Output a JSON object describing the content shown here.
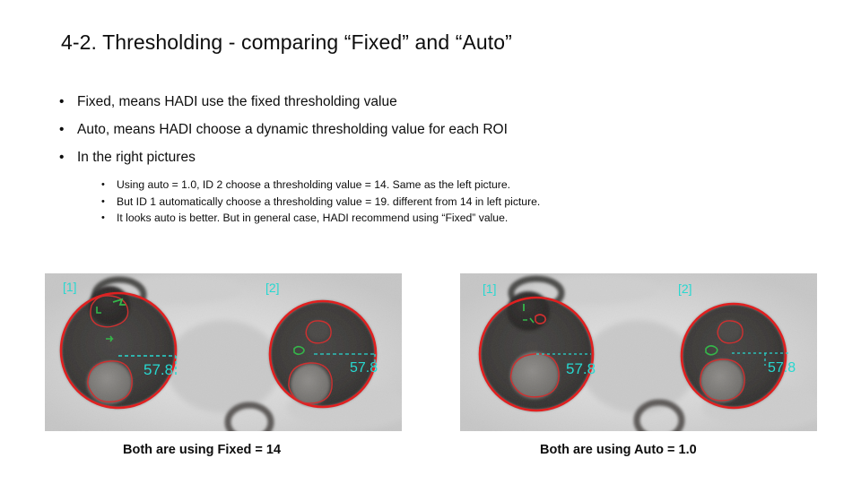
{
  "slide": {
    "title": "4-2. Thresholding  - comparing “Fixed” and “Auto”"
  },
  "bullets": [
    {
      "level": 1,
      "marker": "•",
      "text": "Fixed, means HADI use the fixed thresholding value"
    },
    {
      "level": 1,
      "marker": "•",
      "text": "Auto, means HADI choose a dynamic thresholding value for each ROI"
    },
    {
      "level": 1,
      "marker": "•",
      "text": "In the right pictures"
    }
  ],
  "subbullets": [
    {
      "marker": "•",
      "text": "Using auto = 1.0, ID 2 choose a thresholding value = 14. Same as the left picture."
    },
    {
      "marker": "•",
      "text": "But ID 1 automatically choose a thresholding value = 19. different from 14 in left picture."
    },
    {
      "marker": "•",
      "text": "It looks auto is better. But in general case, HADI recommend using “Fixed” value."
    }
  ],
  "panels": {
    "left": {
      "caption": "Both are using Fixed = 14",
      "roi": [
        {
          "id_label": "[1]",
          "measurement": "57.8"
        },
        {
          "id_label": "[2]",
          "measurement": "57.8"
        }
      ]
    },
    "right": {
      "caption": "Both are using Auto = 1.0",
      "roi": [
        {
          "id_label": "[1]",
          "measurement": "57.8"
        },
        {
          "id_label": "[2]",
          "measurement": "57.8"
        }
      ]
    }
  },
  "colors": {
    "roi_outline": "#e02020",
    "label_cyan": "#27d8d0",
    "annotation_green": "#35b64a",
    "xray_background": "#d6d6d6",
    "xray_dark": "#3a3836",
    "text": "#0d0d0d"
  }
}
